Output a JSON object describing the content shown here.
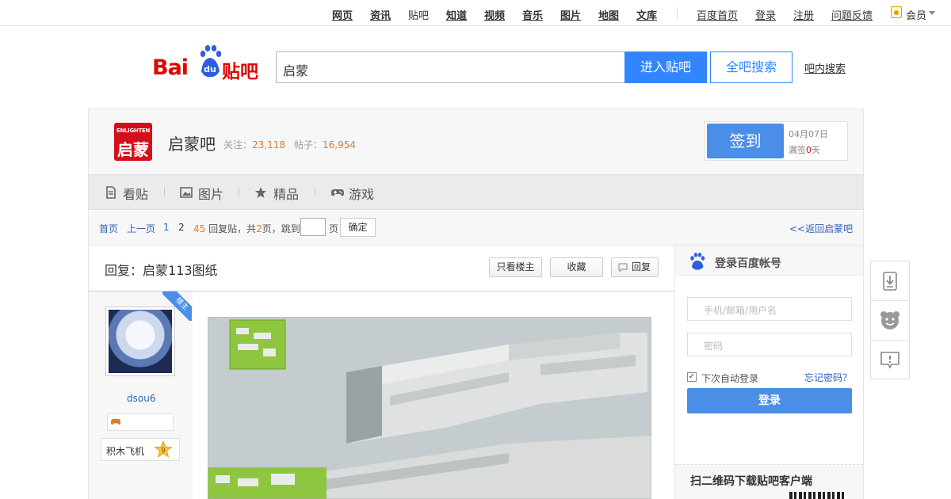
{
  "topnav": {
    "links": [
      "网页",
      "资讯",
      "贴吧",
      "知道",
      "视频",
      "音乐",
      "图片",
      "地图",
      "文库"
    ],
    "right": [
      "百度首页",
      "登录",
      "注册",
      "问题反馈",
      "会员"
    ]
  },
  "logo": {
    "bai": "Bai",
    "du": "du",
    "tieba": "贴吧"
  },
  "search": {
    "value": "启蒙",
    "enter_label": "进入贴吧",
    "all_label": "全吧搜索",
    "inbar_label": "吧内搜索"
  },
  "forum": {
    "logo_small": "ENLIGHTEN",
    "logo_big": "启蒙",
    "name": "启蒙吧",
    "follow_label": "关注：",
    "follow_count": "23,118",
    "posts_label": "帖子：",
    "posts_count": "16,954",
    "sign_label": "签到",
    "sign_date": "04月07日",
    "miss_prefix": "漏签",
    "miss_count": "0",
    "miss_suffix": "天"
  },
  "tabs": [
    "看贴",
    "图片",
    "精品",
    "游戏"
  ],
  "pager": {
    "home": "首页",
    "prev": "上一页",
    "pages": [
      "1",
      "2"
    ],
    "reply_count": "45",
    "info_1": "回复贴，共",
    "total_pages": "2",
    "info_2": "页，跳到",
    "ye": "页",
    "ok": "确定",
    "back": "<<返回启蒙吧"
  },
  "post": {
    "title": "回复：启蒙113图纸",
    "only_owner": "只看楼主",
    "collect": "收藏",
    "reply": "回复",
    "owner_tag": "楼主",
    "author": "dsou6",
    "level_name": "积木飞机",
    "level": "9"
  },
  "login": {
    "title": "登录百度帐号",
    "user_placeholder": "手机/邮箱/用户名",
    "pass_placeholder": "密码",
    "remember": "下次自动登录",
    "forgot": "忘记密码？",
    "submit": "登录",
    "qr_title": "扫二维码下载贴吧客户端"
  },
  "colors": {
    "accent": "#3385ff",
    "brand_red": "#e10601",
    "orange": "#e17c2c",
    "link": "#2d64b3"
  }
}
